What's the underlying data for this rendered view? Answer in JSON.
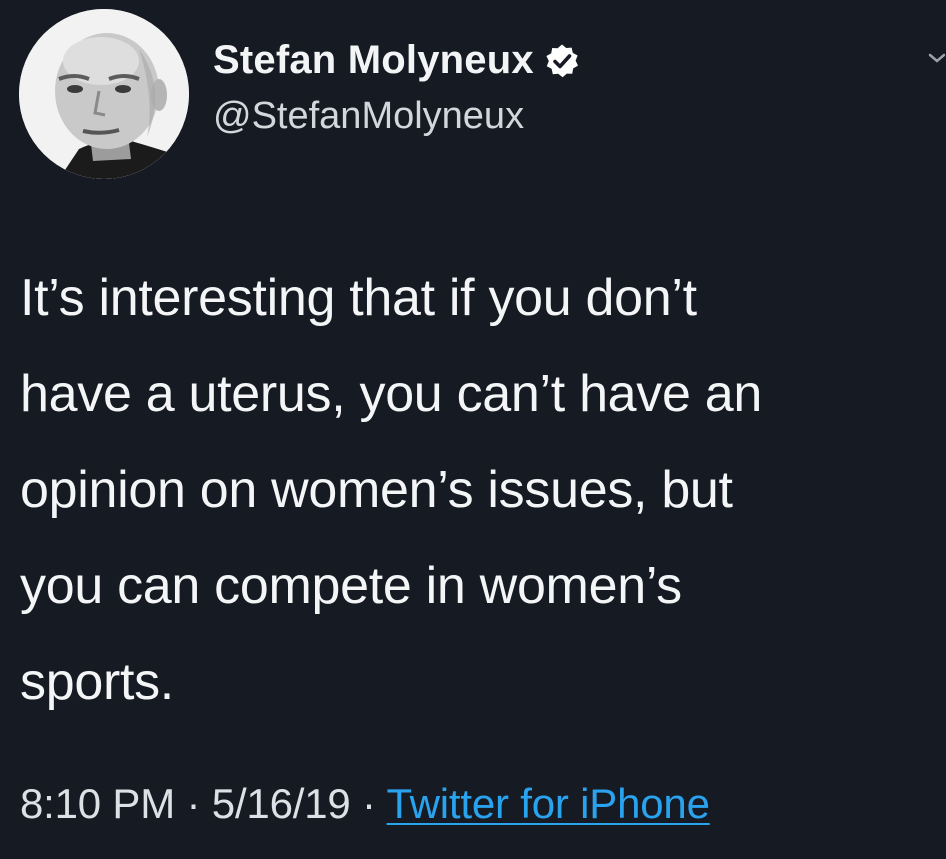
{
  "colors": {
    "background": "#161a22",
    "text": "#f3f5f7",
    "link": "#2aa3ef",
    "verified_badge": "#ffffff"
  },
  "author": {
    "display_name": "Stefan Molyneux",
    "handle": "@StefanMolyneux",
    "verified": true,
    "avatar_icon": "profile-photo",
    "badge_icon": "verified-check-icon"
  },
  "menu": {
    "icon": "chevron-down-icon"
  },
  "tweet": {
    "lines": [
      "It’s interesting that if you don’t",
      "have a uterus, you can’t have an",
      "opinion on women’s issues, but",
      "you can compete in women’s",
      "sports."
    ]
  },
  "meta": {
    "time": "8:10 PM",
    "separator": "·",
    "date": "5/16/19",
    "source": "Twitter for iPhone"
  }
}
